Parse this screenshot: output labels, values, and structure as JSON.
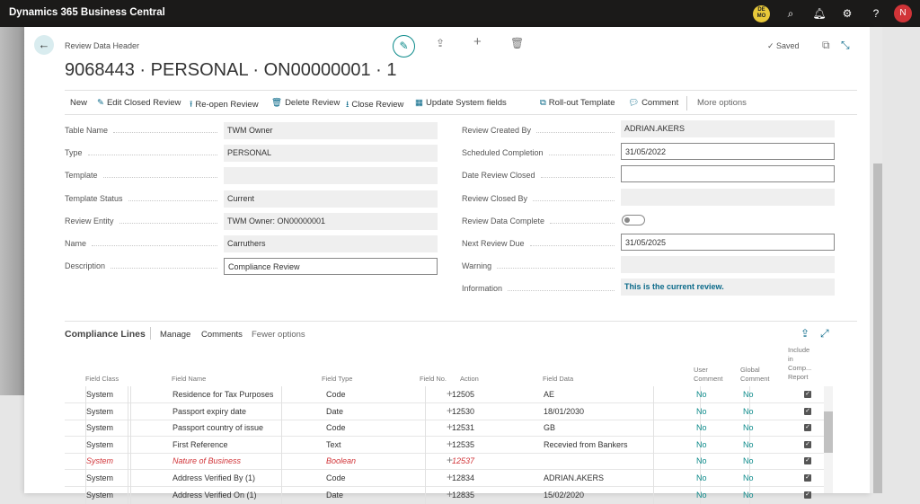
{
  "app": {
    "title": "Dynamics 365 Business Central",
    "demo_badge": "DE MO",
    "avatar": "N"
  },
  "header": {
    "breadcrumb": "Review Data Header",
    "title": "9068443 · PERSONAL · ON00000001 · 1",
    "saved": "Saved"
  },
  "actions": [
    "New",
    "Edit Closed Review",
    "Re-open Review",
    "Delete Review",
    "Close Review",
    "Update System fields",
    "Roll-out Template",
    "Comment",
    "More options"
  ],
  "left_fields": [
    {
      "label": "Table Name",
      "value": "TWM Owner"
    },
    {
      "label": "Type",
      "value": "PERSONAL"
    },
    {
      "label": "Template",
      "value": ""
    },
    {
      "label": "Template Status",
      "value": "Current"
    },
    {
      "label": "Review Entity",
      "value": "TWM Owner: ON00000001"
    },
    {
      "label": "Name",
      "value": "Carruthers"
    },
    {
      "label": "Description",
      "value": "Compliance Review"
    }
  ],
  "right_fields": [
    {
      "label": "Review Created By",
      "value": "ADRIAN.AKERS"
    },
    {
      "label": "Scheduled Completion",
      "value": "31/05/2022"
    },
    {
      "label": "Date Review Closed",
      "value": ""
    },
    {
      "label": "Review Closed By",
      "value": ""
    },
    {
      "label": "Review Data Complete",
      "value": ""
    },
    {
      "label": "Next Review Due",
      "value": "31/05/2025"
    },
    {
      "label": "Warning",
      "value": ""
    },
    {
      "label": "Information",
      "value": "This is the current review."
    }
  ],
  "lines": {
    "title": "Compliance Lines",
    "actions": [
      "Manage",
      "Comments",
      "Fewer options"
    ],
    "columns": [
      "Field Class",
      "Field Name",
      "Field Type",
      "Field No.",
      "Action",
      "Field Data",
      "User Comment",
      "Global Comment",
      "Include in Comp... Report"
    ],
    "rows": [
      {
        "cls": "System",
        "name": "Residence for Tax Purposes",
        "type": "Code",
        "no": "12505",
        "data": "AE",
        "uc": "No",
        "gc": "No"
      },
      {
        "cls": "System",
        "name": "Passport expiry date",
        "type": "Date",
        "no": "12530",
        "data": "18/01/2030",
        "uc": "No",
        "gc": "No"
      },
      {
        "cls": "System",
        "name": "Passport country of issue",
        "type": "Code",
        "no": "12531",
        "data": "GB",
        "uc": "No",
        "gc": "No"
      },
      {
        "cls": "System",
        "name": "First Reference",
        "type": "Text",
        "no": "12535",
        "data": "Recevied from Bankers",
        "uc": "No",
        "gc": "No"
      },
      {
        "cls": "System",
        "name": "Nature of Business",
        "type": "Boolean",
        "no": "12537",
        "data": "",
        "uc": "No",
        "gc": "No"
      },
      {
        "cls": "System",
        "name": "Address Verified By (1)",
        "type": "Code",
        "no": "12834",
        "data": "ADRIAN.AKERS",
        "uc": "No",
        "gc": "No"
      },
      {
        "cls": "System",
        "name": "Address Verified On (1)",
        "type": "Date",
        "no": "12835",
        "data": "15/02/2020",
        "uc": "No",
        "gc": "No"
      }
    ]
  }
}
